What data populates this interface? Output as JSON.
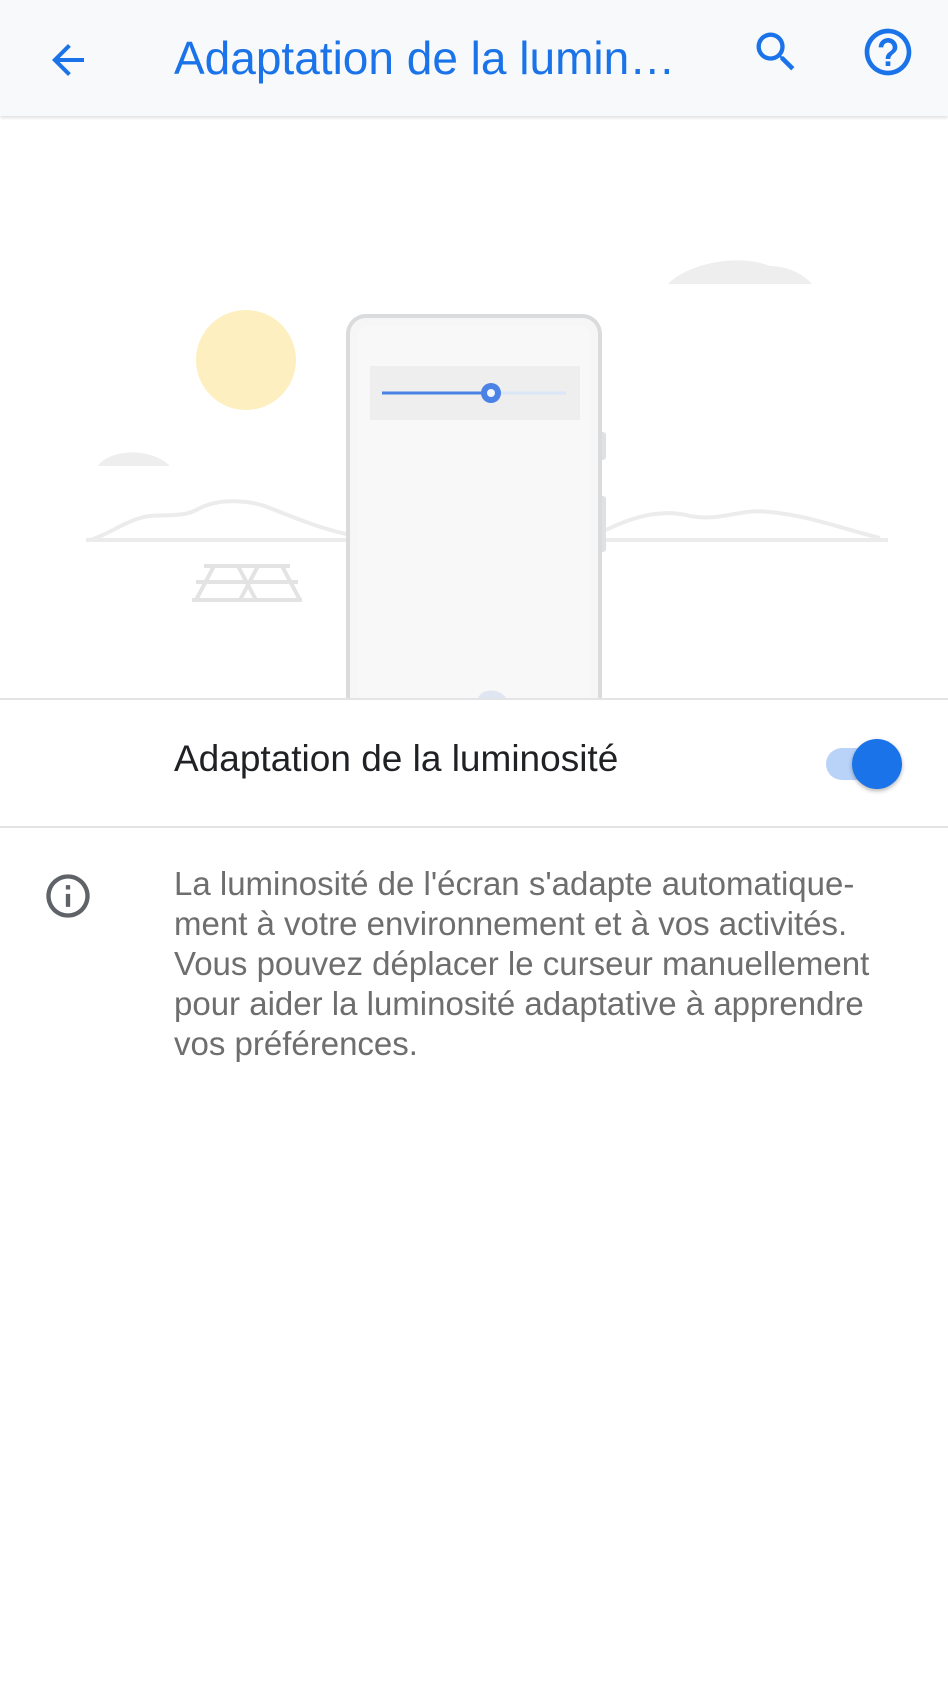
{
  "appbar": {
    "title": "Adaptation de la luminosité",
    "back_icon": "arrow-back-icon",
    "search_icon": "search-icon",
    "help_icon": "help-circle-icon",
    "accent_color": "#1a73e8"
  },
  "illustration": {
    "brightness_slider_level": 0.6
  },
  "setting": {
    "label": "Adaptation de la luminosité",
    "enabled": true
  },
  "info": {
    "icon": "info-icon",
    "text": "La luminosité de l'écran s'adapte automatique-ment à votre environnement et à vos activités. Vous pouvez déplacer le curseur manuellement pour aider la luminosité adaptative à apprendre vos préférences."
  }
}
